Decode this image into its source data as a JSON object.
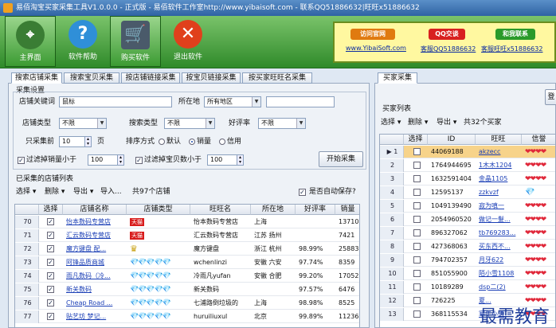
{
  "window": {
    "title": "易佰淘宝买家采集工具V1.0.0.0 - 正式版 - 易佰软件工作室http://www.yibaisoft.com - 联系QQ51886632|旺旺x51886632"
  },
  "toolbar": {
    "buttons": [
      {
        "label": "主界面",
        "icon": "antenna-icon"
      },
      {
        "label": "软件帮助",
        "icon": "help-icon"
      },
      {
        "label": "购买软件",
        "icon": "cart-icon"
      },
      {
        "label": "退出软件",
        "icon": "exit-icon"
      }
    ]
  },
  "ads": {
    "logo1": "访问官网",
    "link1": "www.YibaiSoft.com",
    "logo2": "QQ交谈",
    "link2": "客服QQ51886632",
    "logo3": "和我联系",
    "link3": "客服旺旺x51886632"
  },
  "tabs": [
    "搜索店铺采集",
    "搜索宝贝采集",
    "按店铺链接采集",
    "按宝贝链接采集",
    "按买家旺旺名采集"
  ],
  "settings": {
    "group": "采集设置",
    "keyword_label": "店铺关键词",
    "keyword_value": "鼠标",
    "location_label": "所在地",
    "location_value": "所有地区",
    "shop_type_label": "店铺类型",
    "shop_type_value": "不限",
    "search_type_label": "搜索类型",
    "search_type_value": "不限",
    "rating_label": "好评率",
    "rating_value": "不限",
    "pages_label": "只采集前",
    "pages_value": "10",
    "pages_unit": "页",
    "sort_label": "排序方式",
    "sort_options": [
      "默认",
      "销量",
      "信用"
    ],
    "sales_filter_label": "过滤掉销量小于",
    "sales_filter_value": "100",
    "items_filter_label": "过滤掉宝贝数小于",
    "items_filter_value": "100",
    "start_button": "开始采集"
  },
  "shop_list": {
    "title": "已采集的店铺列表",
    "toolbar": [
      "选择",
      "删除",
      "导出",
      "导入..."
    ],
    "count": "共97个店铺",
    "autosave": "是否自动保存?",
    "headers": [
      "选择",
      "店铺名称",
      "店铺类型",
      "旺旺名",
      "所在地",
      "好评率",
      "销量"
    ],
    "rows": [
      {
        "no": "70",
        "name": "怡本数码专营店",
        "type": "tmall",
        "wangwang": "怡本数码专营店",
        "loc": "上海",
        "rate": "",
        "sales": "13710"
      },
      {
        "no": "71",
        "name": "汇云数码专营店",
        "type": "tmall",
        "wangwang": "汇云数码专营店",
        "loc": "江苏 扬州",
        "rate": "",
        "sales": "7421"
      },
      {
        "no": "72",
        "name": "魔方键盘 配...",
        "type": "crown",
        "wangwang": "魔方键盘",
        "loc": "浙江 杭州",
        "rate": "98.99%",
        "sales": "25883"
      },
      {
        "no": "73",
        "name": "阿锋品质商城",
        "type": "diamond",
        "wangwang": "wchenlinzi",
        "loc": "安徽 六安",
        "rate": "97.74%",
        "sales": "8359"
      },
      {
        "no": "74",
        "name": "雨凡数码（冷...",
        "type": "diamond",
        "wangwang": "冷雨凡yufan",
        "loc": "安徽 合肥",
        "rate": "99.20%",
        "sales": "17052"
      },
      {
        "no": "75",
        "name": "新关数码",
        "type": "diamond",
        "wangwang": "新关数码",
        "loc": "",
        "rate": "97.57%",
        "sales": "6476"
      },
      {
        "no": "76",
        "name": "Cheap Road ...",
        "type": "diamond",
        "wangwang": "七浦路倒垃圾的",
        "loc": "上海",
        "rate": "98.98%",
        "sales": "8525"
      },
      {
        "no": "77",
        "name": "贴艺坊 梦记...",
        "type": "diamond",
        "wangwang": "huruiliuxul",
        "loc": "北京",
        "rate": "99.89%",
        "sales": "11236"
      }
    ]
  },
  "buyer_panel": {
    "tab": "买家采集",
    "group": "买家列表",
    "toolbar": [
      "选择",
      "删除",
      "导出"
    ],
    "count": "共32个买家",
    "headers": [
      "选择",
      "ID",
      "旺旺",
      "信誉"
    ],
    "rows": [
      {
        "no": "1",
        "id": "44069188",
        "ww": "akzecc",
        "credit": "hearts"
      },
      {
        "no": "2",
        "id": "1764944695",
        "ww": "1木木1204",
        "credit": "hearts"
      },
      {
        "no": "3",
        "id": "1632591404",
        "ww": "金晶1105",
        "credit": "hearts"
      },
      {
        "no": "4",
        "id": "12595137",
        "ww": "zzkvzf",
        "credit": "diamond"
      },
      {
        "no": "5",
        "id": "1049139490",
        "ww": "寂为嗔一",
        "credit": "hearts"
      },
      {
        "no": "6",
        "id": "2054960520",
        "ww": "做记一髮...",
        "credit": "hearts"
      },
      {
        "no": "7",
        "id": "896327062",
        "ww": "tb769283...",
        "credit": "hearts"
      },
      {
        "no": "8",
        "id": "427368063",
        "ww": "买东西不...",
        "credit": "hearts"
      },
      {
        "no": "9",
        "id": "794702357",
        "ww": "月牙622",
        "credit": "hearts"
      },
      {
        "no": "10",
        "id": "851055900",
        "ww": "陌小雪1108",
        "credit": "hearts"
      },
      {
        "no": "11",
        "id": "10189289",
        "ww": "dsp二(2)",
        "credit": "hearts"
      },
      {
        "no": "12",
        "id": "726225",
        "ww": "夏...",
        "credit": "hearts"
      },
      {
        "no": "13",
        "id": "368115534",
        "ww": "寒年小谱",
        "credit": "hearts"
      }
    ],
    "side_button": "登"
  },
  "watermark": "最需教育"
}
